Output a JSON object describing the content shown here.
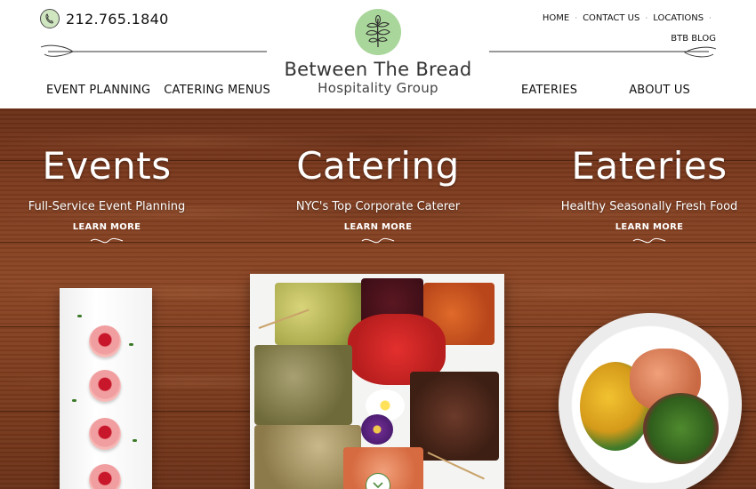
{
  "header": {
    "phone": "212.765.1840",
    "phone_icon": "phone-icon",
    "logo": {
      "name": "Between The Bread",
      "subtitle": "Hospitality Group",
      "icon": "leaf-sprig-icon",
      "accent": "#a9d69a"
    },
    "util_nav": [
      {
        "label": "HOME"
      },
      {
        "label": "CONTACT US"
      },
      {
        "label": "LOCATIONS"
      }
    ],
    "blog_link": "BTB BLOG",
    "nav_left": [
      {
        "label": "EVENT PLANNING"
      },
      {
        "label": "CATERING MENUS"
      }
    ],
    "nav_right": [
      {
        "label": "EATERIES"
      },
      {
        "label": "ABOUT US"
      }
    ]
  },
  "hero": {
    "columns": [
      {
        "title": "Events",
        "subtitle": "Full-Service Event Planning",
        "cta": "LEARN MORE"
      },
      {
        "title": "Catering",
        "subtitle": "NYC's Top Corporate Caterer",
        "cta": "LEARN MORE"
      },
      {
        "title": "Eateries",
        "subtitle": "Healthy Seasonally Fresh Food",
        "cta": "LEARN MORE"
      }
    ],
    "scroll_icon": "chevron-down-icon"
  },
  "colors": {
    "brand_green": "#4c8a3a",
    "wood": "#7c3a1d",
    "text_dark": "#111111"
  }
}
